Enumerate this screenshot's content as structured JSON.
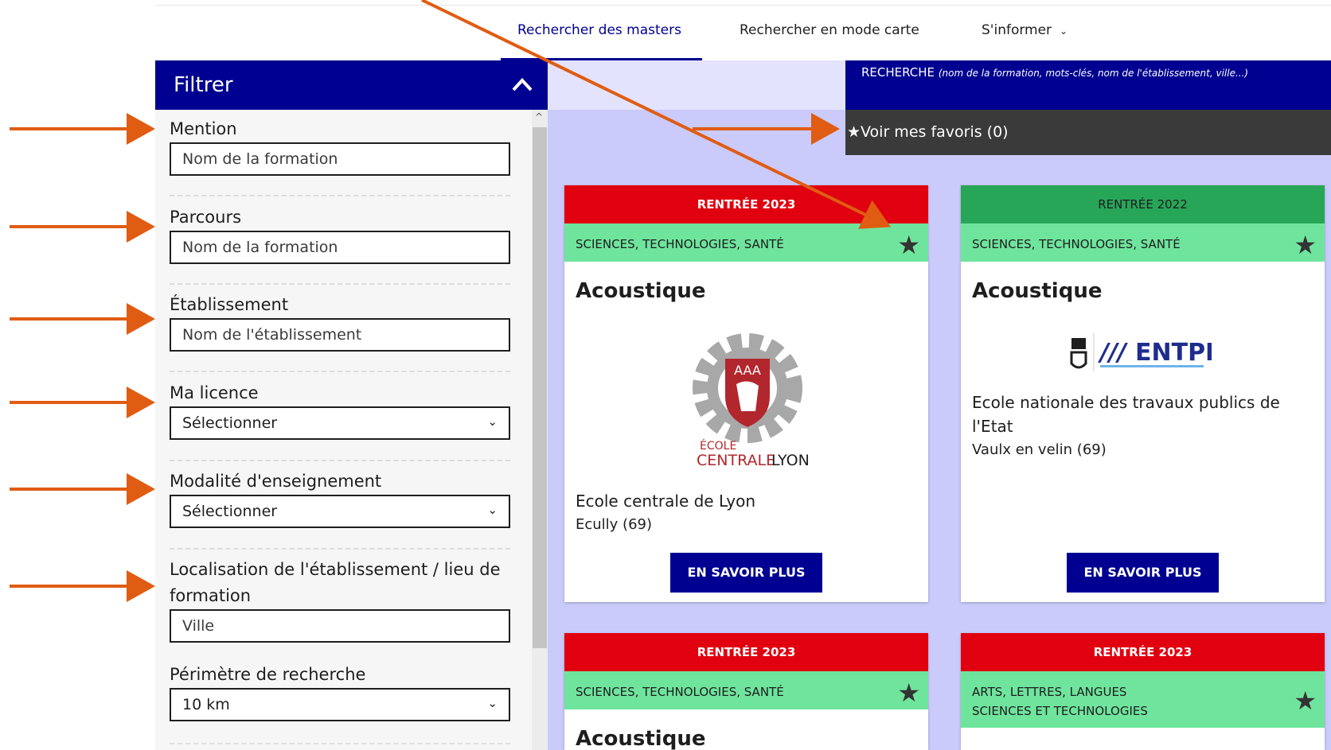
{
  "nav": {
    "tabs": [
      {
        "label": "Rechercher des masters"
      },
      {
        "label": "Rechercher en mode carte"
      },
      {
        "label": "S'informer"
      }
    ]
  },
  "search": {
    "label": "RECHERCHE",
    "hint": "(nom de la formation, mots-clés, nom de l'établissement, ville...)"
  },
  "favorites": {
    "label": "★Voir mes favoris (0)"
  },
  "filter": {
    "title": "Filtrer",
    "groups": [
      {
        "label": "Mention",
        "value": "Nom de la formation"
      },
      {
        "label": "Parcours",
        "value": "Nom de la formation"
      },
      {
        "label": "Établissement",
        "value": "Nom de l'établissement"
      },
      {
        "label": "Ma licence",
        "value": "Sélectionner"
      },
      {
        "label": "Modalité d'enseignement",
        "value": "Sélectionner"
      },
      {
        "label": "Localisation de l'établissement / lieu de formation",
        "value": "Ville"
      },
      {
        "label": "Périmètre de recherche",
        "value": "10 km"
      }
    ]
  },
  "cards": [
    {
      "rentree": "RENTRÉE 2023",
      "domain": "SCIENCES, TECHNOLOGIES, SANTÉ",
      "title": "Acoustique",
      "etablissement": "Ecole centrale de Lyon",
      "city": "Ecully (69)",
      "button": "EN SAVOIR PLUS",
      "logo_text_top": "ÉCOLE",
      "logo_text_a": "CENTRALE",
      "logo_text_b": "LYON"
    },
    {
      "rentree": "RENTRÉE 2022",
      "domain": "SCIENCES, TECHNOLOGIES, SANTÉ",
      "title": "Acoustique",
      "etablissement": "Ecole nationale des travaux publics de l'Etat",
      "city": "Vaulx en velin (69)",
      "button": "EN SAVOIR PLUS",
      "logo_text": "ENTPE"
    },
    {
      "rentree": "RENTRÉE 2023",
      "domain": "SCIENCES, TECHNOLOGIES, SANTÉ",
      "title": "Acoustique"
    },
    {
      "rentree": "RENTRÉE 2023",
      "domain_line1": "ARTS, LETTRES, LANGUES",
      "domain_line2": "SCIENCES ET TECHNOLOGIES"
    }
  ],
  "colors": {
    "primary": "#000091",
    "rentree_red": "#e1000f",
    "rentree_green": "#27a658",
    "domain_green": "#6fe49d",
    "results_bg": "#cacafb",
    "arrow": "#e05c12"
  }
}
